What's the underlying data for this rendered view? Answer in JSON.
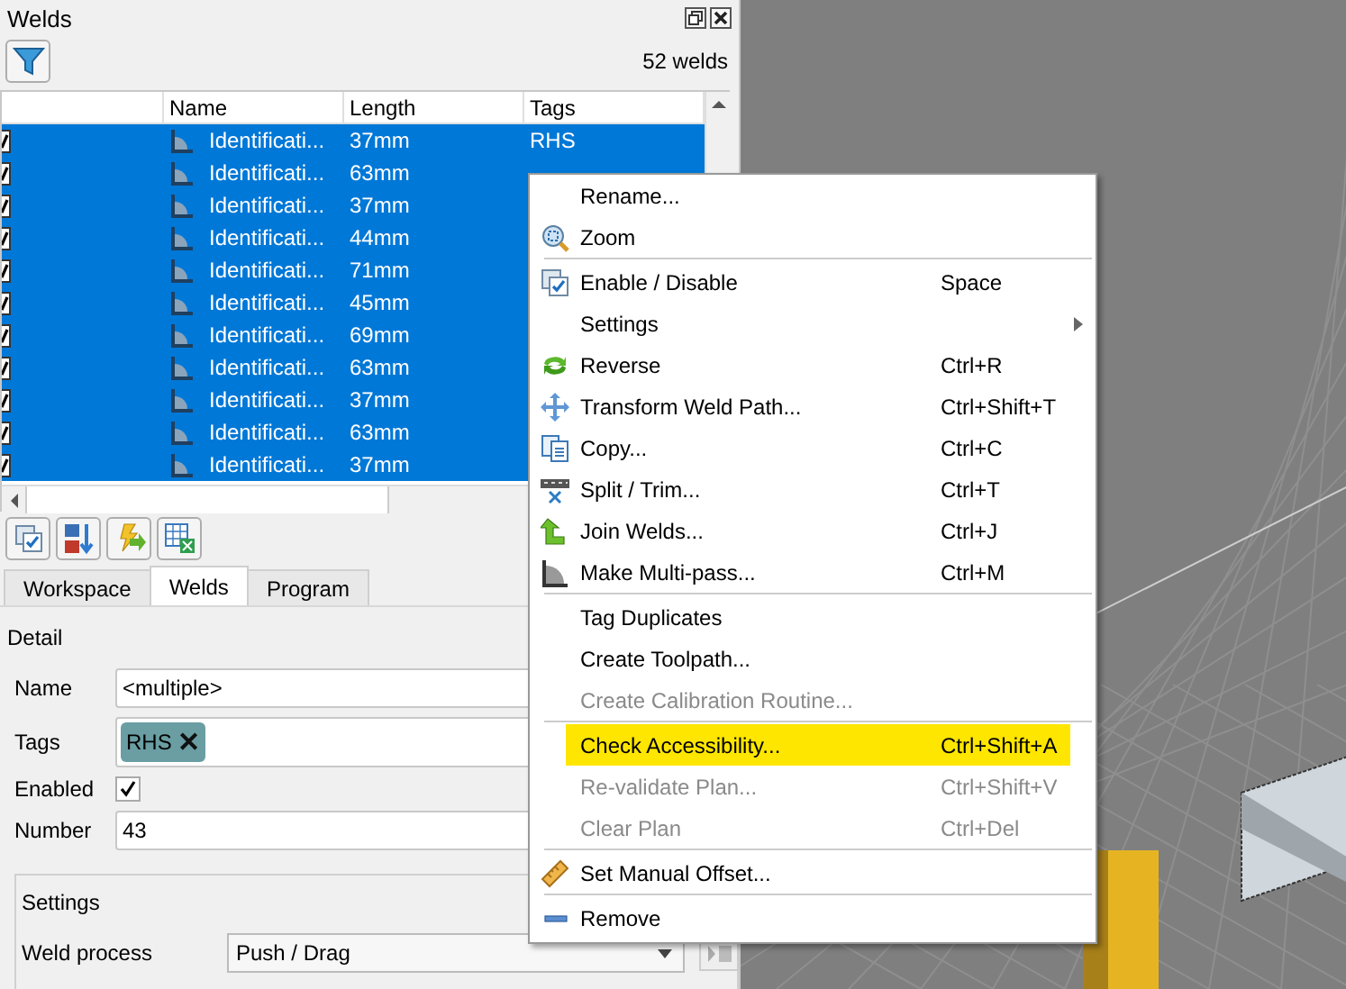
{
  "panel": {
    "title": "Welds",
    "count": "52 welds"
  },
  "table": {
    "columns": [
      "Name",
      "Length",
      "Tags"
    ],
    "rows": [
      {
        "checked": true,
        "selected": true,
        "name": "Identificati...",
        "length": "37mm",
        "tags": "RHS"
      },
      {
        "checked": true,
        "selected": true,
        "name": "Identificati...",
        "length": "63mm"
      },
      {
        "checked": true,
        "selected": true,
        "name": "Identificati...",
        "length": "37mm"
      },
      {
        "checked": true,
        "selected": true,
        "name": "Identificati...",
        "length": "44mm"
      },
      {
        "checked": true,
        "selected": true,
        "name": "Identificati...",
        "length": "71mm"
      },
      {
        "checked": true,
        "selected": true,
        "name": "Identificati...",
        "length": "45mm"
      },
      {
        "checked": true,
        "selected": true,
        "name": "Identificati...",
        "length": "69mm"
      },
      {
        "checked": true,
        "selected": true,
        "name": "Identificati...",
        "length": "63mm"
      },
      {
        "checked": true,
        "selected": true,
        "name": "Identificati...",
        "length": "37mm"
      },
      {
        "checked": true,
        "selected": true,
        "name": "Identificati...",
        "length": "63mm"
      },
      {
        "checked": true,
        "selected": true,
        "name": "Identificati...",
        "length": "37mm"
      }
    ]
  },
  "tabs": [
    {
      "label": "Workspace",
      "selected": false
    },
    {
      "label": "Welds",
      "selected": true
    },
    {
      "label": "Program",
      "selected": false
    }
  ],
  "detail": {
    "heading": "Detail",
    "name_label": "Name",
    "name_value": "<multiple>",
    "tags_label": "Tags",
    "tags": [
      "RHS"
    ],
    "tag_remove": "✕",
    "enabled_label": "Enabled",
    "enabled": true,
    "number_label": "Number",
    "number_value": "43"
  },
  "settings": {
    "heading": "Settings",
    "process_label": "Weld process",
    "process_value": "Push / Drag"
  },
  "menu": [
    {
      "kind": "item",
      "label": "Rename...",
      "disabled": false,
      "selected": false,
      "submenu": false
    },
    {
      "kind": "item",
      "label": "Zoom",
      "disabled": false,
      "selected": false,
      "submenu": false
    },
    {
      "kind": "separator"
    },
    {
      "kind": "item",
      "label": "Enable / Disable",
      "shortcut": "Space",
      "disabled": false,
      "selected": false,
      "submenu": false
    },
    {
      "kind": "item",
      "label": "Settings",
      "disabled": false,
      "selected": false,
      "submenu": true
    },
    {
      "kind": "item",
      "label": "Reverse",
      "shortcut": "Ctrl+R",
      "disabled": false,
      "selected": false,
      "submenu": false
    },
    {
      "kind": "item",
      "label": "Transform Weld Path...",
      "shortcut": "Ctrl+Shift+T",
      "disabled": false,
      "selected": false,
      "submenu": false
    },
    {
      "kind": "item",
      "label": "Copy...",
      "shortcut": "Ctrl+C",
      "disabled": false,
      "selected": false,
      "submenu": false
    },
    {
      "kind": "item",
      "label": "Split / Trim...",
      "shortcut": "Ctrl+T",
      "disabled": false,
      "selected": false,
      "submenu": false
    },
    {
      "kind": "item",
      "label": "Join Welds...",
      "shortcut": "Ctrl+J",
      "disabled": false,
      "selected": false,
      "submenu": false
    },
    {
      "kind": "item",
      "label": "Make Multi-pass...",
      "shortcut": "Ctrl+M",
      "disabled": false,
      "selected": false,
      "submenu": false
    },
    {
      "kind": "separator"
    },
    {
      "kind": "item",
      "label": "Tag Duplicates",
      "disabled": false,
      "selected": false,
      "submenu": false
    },
    {
      "kind": "item",
      "label": "Create Toolpath...",
      "disabled": false,
      "selected": false,
      "submenu": false
    },
    {
      "kind": "item",
      "label": "Create Calibration Routine...",
      "disabled": true,
      "selected": false,
      "submenu": false
    },
    {
      "kind": "separator"
    },
    {
      "kind": "item",
      "label": "Check Accessibility...",
      "shortcut": "Ctrl+Shift+A",
      "disabled": false,
      "selected": true,
      "submenu": false
    },
    {
      "kind": "item",
      "label": "Re-validate Plan...",
      "shortcut": "Ctrl+Shift+V",
      "disabled": true,
      "selected": false,
      "submenu": false
    },
    {
      "kind": "item",
      "label": "Clear Plan",
      "shortcut": "Ctrl+Del",
      "disabled": true,
      "selected": false,
      "submenu": false
    },
    {
      "kind": "separator"
    },
    {
      "kind": "item",
      "label": "Set Manual Offset...",
      "disabled": false,
      "selected": false,
      "submenu": false
    },
    {
      "kind": "separator"
    },
    {
      "kind": "item",
      "label": "Remove",
      "disabled": false,
      "selected": false,
      "submenu": false
    }
  ]
}
